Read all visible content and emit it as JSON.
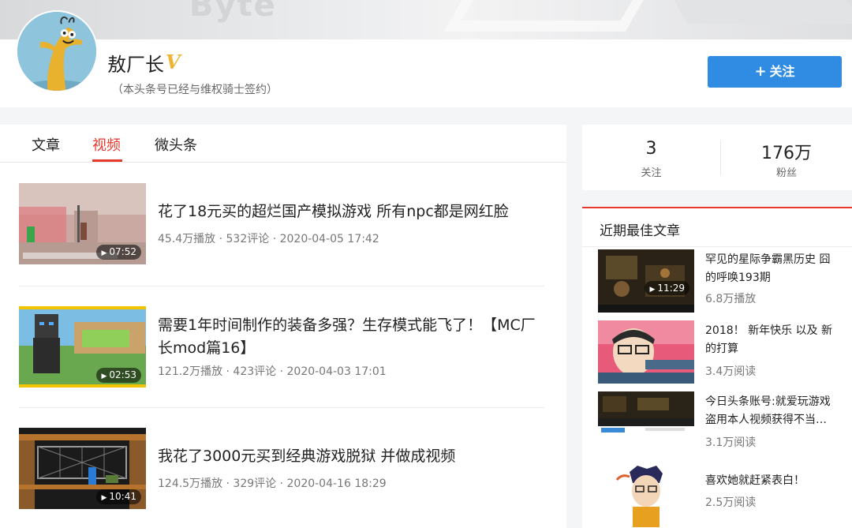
{
  "banner": {
    "bg_word": "Byte"
  },
  "profile": {
    "name": "敖厂长",
    "verified_mark": "V",
    "subtitle": "（本头条号已经与维权骑士签约）",
    "follow_button": "关注",
    "follow_icon": "plus-icon"
  },
  "tabs": [
    {
      "label": "文章",
      "active": false
    },
    {
      "label": "视频",
      "active": true
    },
    {
      "label": "微头条",
      "active": false
    }
  ],
  "videos": [
    {
      "title": "花了18元买的超烂国产模拟游戏 所有npc都是网红脸",
      "duration": "07:52",
      "meta": "45.4万播放 · 532评论 · 2020-04-05 17:42"
    },
    {
      "title": "需要1年时间制作的装备多强？生存模式能飞了！【MC厂长mod篇16】",
      "duration": "02:53",
      "meta": "121.2万播放 · 423评论 · 2020-04-03 17:01"
    },
    {
      "title": "我花了3000元买到经典游戏脱狱 并做成视频",
      "duration": "10:41",
      "meta": "124.5万播放 · 329评论 · 2020-04-16 18:29"
    }
  ],
  "stats": {
    "following_count": "3",
    "following_label": "关注",
    "fans_count": "176万",
    "fans_label": "粉丝"
  },
  "best_articles": {
    "heading": "近期最佳文章",
    "items": [
      {
        "title": "罕见的星际争霸黑历史 囧的呼唤193期",
        "duration": "11:29",
        "meta": "6.8万播放"
      },
      {
        "title": "2018！ 新年快乐 以及 新的打算",
        "duration": "",
        "meta": "3.4万阅读"
      },
      {
        "title": "今日头条账号:就爱玩游戏盗用本人视频获得不当…",
        "duration": "",
        "meta": "3.1万阅读"
      },
      {
        "title": "喜欢她就赶紧表白！",
        "duration": "",
        "meta": "2.5万阅读"
      }
    ]
  },
  "colors": {
    "accent_red": "#e8382c",
    "button_blue": "#2f8ce2",
    "verified_gold": "#f0b433"
  }
}
